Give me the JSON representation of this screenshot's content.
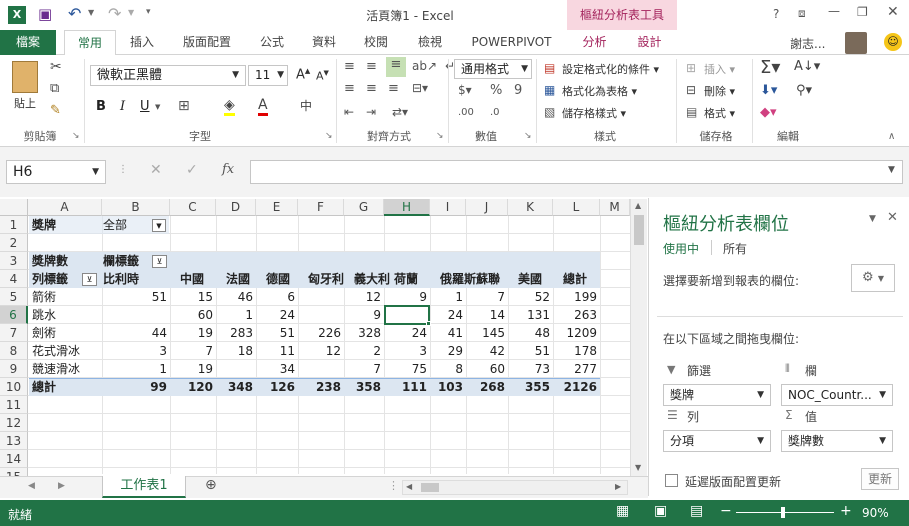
{
  "window": {
    "title": "活頁簿1 - Excel",
    "context_tab": "樞紐分析表工具",
    "user": "謝志..."
  },
  "colors": {
    "excel_green": "#217346",
    "pivot_header": "#dce6f1",
    "context_tab": "#f8d7e0",
    "context_text": "#a3235c"
  },
  "tabs": [
    "檔案",
    "常用",
    "插入",
    "版面配置",
    "公式",
    "資料",
    "校閱",
    "檢視",
    "POWERPIVOT",
    "分析",
    "設計"
  ],
  "ribbon": {
    "clipboard": {
      "paste": "貼上",
      "label": "剪貼簿"
    },
    "font": {
      "name": "微軟正黑體",
      "size": "11",
      "label": "字型"
    },
    "align": {
      "label": "對齊方式"
    },
    "number": {
      "format": "通用格式",
      "label": "數值"
    },
    "styles": {
      "cond": "設定格式化的條件",
      "table": "格式化為表格",
      "cell": "儲存格樣式",
      "label": "樣式"
    },
    "cells": {
      "insert": "插入",
      "delete": "刪除",
      "format": "格式",
      "label": "儲存格"
    },
    "edit": {
      "label": "編輯"
    }
  },
  "formula": {
    "namebox": "H6",
    "fx": "fx",
    "value": ""
  },
  "columns": [
    "A",
    "B",
    "C",
    "D",
    "E",
    "F",
    "G",
    "H",
    "I",
    "J",
    "K",
    "L",
    "M"
  ],
  "rows": [
    "1",
    "2",
    "3",
    "4",
    "5",
    "6",
    "7",
    "8",
    "9",
    "10",
    "11",
    "12",
    "13",
    "14",
    "15"
  ],
  "pivot": {
    "filter_label": "獎牌",
    "filter_value": "全部",
    "value_label": "獎牌數",
    "col_label": "欄標籤",
    "row_label": "列標籤",
    "col_headers": [
      "比利時",
      "中國",
      "法國",
      "德國",
      "匈牙利",
      "義大利",
      "荷蘭",
      "俄羅斯",
      "蘇聯",
      "美國",
      "總計"
    ],
    "rows": [
      {
        "label": "箭術",
        "values": [
          "51",
          "15",
          "46",
          "6",
          "",
          "12",
          "9",
          "1",
          "7",
          "52",
          "199"
        ]
      },
      {
        "label": "跳水",
        "values": [
          "",
          "60",
          "1",
          "24",
          "",
          "9",
          "",
          "24",
          "14",
          "131",
          "263"
        ]
      },
      {
        "label": "劍術",
        "values": [
          "44",
          "19",
          "283",
          "51",
          "226",
          "328",
          "24",
          "41",
          "145",
          "48",
          "1209"
        ]
      },
      {
        "label": "花式滑冰",
        "values": [
          "3",
          "7",
          "18",
          "11",
          "12",
          "2",
          "3",
          "29",
          "42",
          "51",
          "178"
        ]
      },
      {
        "label": "競速滑冰",
        "values": [
          "1",
          "19",
          "",
          "34",
          "",
          "7",
          "75",
          "8",
          "60",
          "73",
          "277"
        ]
      }
    ],
    "total_row": {
      "label": "總計",
      "values": [
        "99",
        "120",
        "348",
        "126",
        "238",
        "358",
        "111",
        "103",
        "268",
        "355",
        "2126"
      ]
    }
  },
  "pane": {
    "title": "樞紐分析表欄位",
    "tab_active": "使用中",
    "tab_all": "所有",
    "choose": "選擇要新增到報表的欄位:",
    "drag": "在以下區域之間拖曳欄位:",
    "filter_h": "篩選",
    "col_h": "欄",
    "row_h": "列",
    "val_h": "值",
    "filter_item": "獎牌",
    "col_item": "NOC_Countr...",
    "row_item": "分項",
    "val_item": "獎牌數",
    "defer": "延遲版面配置更新",
    "update": "更新"
  },
  "sheet": {
    "tab": "工作表1"
  },
  "status": {
    "ready": "就緒",
    "zoom": "90%"
  }
}
